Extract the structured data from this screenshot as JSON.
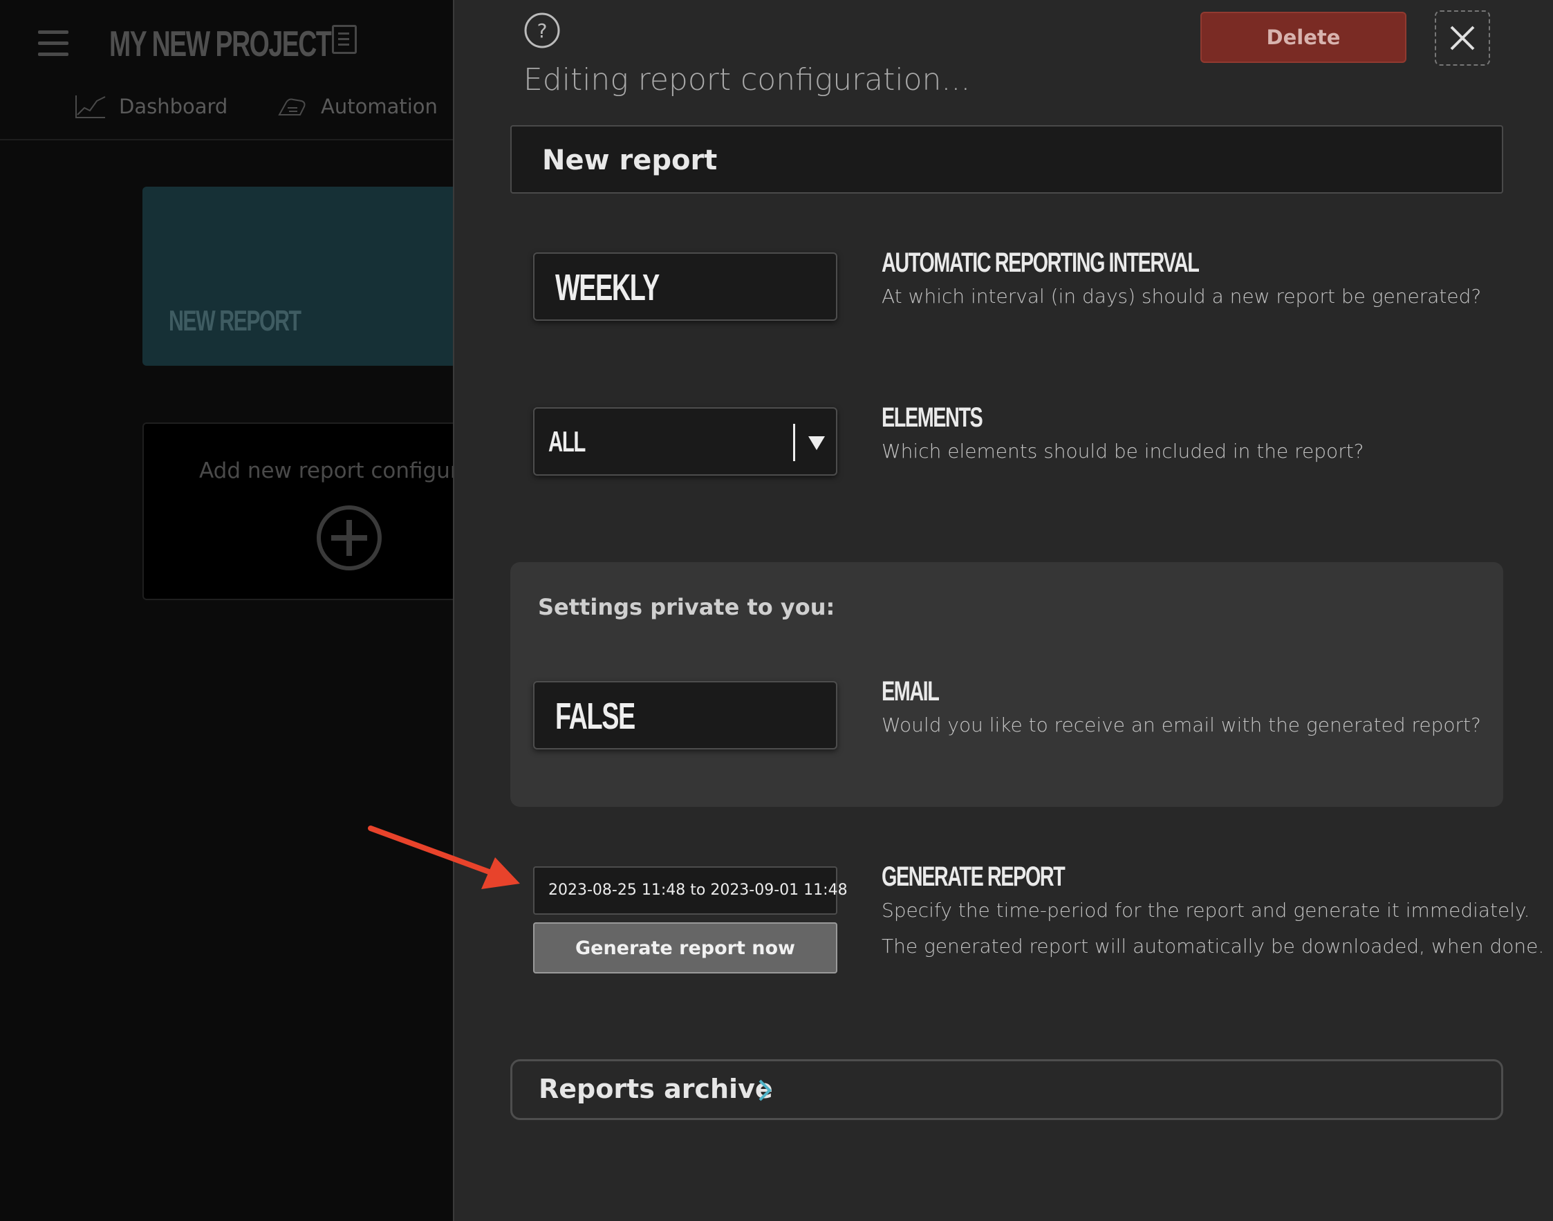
{
  "background": {
    "project_title": "MY NEW PROJECT",
    "nav": [
      {
        "label": "Dashboard",
        "icon": "chart-line-icon"
      },
      {
        "label": "Automation",
        "icon": "hand-icon"
      }
    ],
    "report_card_title": "NEW REPORT",
    "add_card_text": "Add new report configuration"
  },
  "panel": {
    "title": "Editing report configuration...",
    "delete_label": "Delete",
    "report_name": "New report",
    "settings": {
      "interval": {
        "value": "WEEKLY",
        "label": "AUTOMATIC REPORTING INTERVAL",
        "desc": "At which interval (in days) should a new report be generated?"
      },
      "elements": {
        "value": "ALL",
        "label": "ELEMENTS",
        "desc": "Which elements should be included in the report?"
      }
    },
    "private": {
      "title": "Settings private to you:",
      "email": {
        "value": "FALSE",
        "label": "EMAIL",
        "desc": "Would you like to receive an email with the generated report?"
      }
    },
    "generate": {
      "date_range": "2023-08-25 11:48 to 2023-09-01 11:48",
      "button_label": "Generate report now",
      "label": "GENERATE REPORT",
      "desc1": "Specify the time-period for the report and generate it immediately.",
      "desc2": "The generated report will automatically be downloaded, when done."
    },
    "archive_label": "Reports archive"
  },
  "colors": {
    "panel_bg": "#282828",
    "delete_bg": "#7a2b24",
    "accent_teal": "#4fb3c8",
    "annotation_arrow": "#e8432b",
    "card_teal": "#163036"
  }
}
